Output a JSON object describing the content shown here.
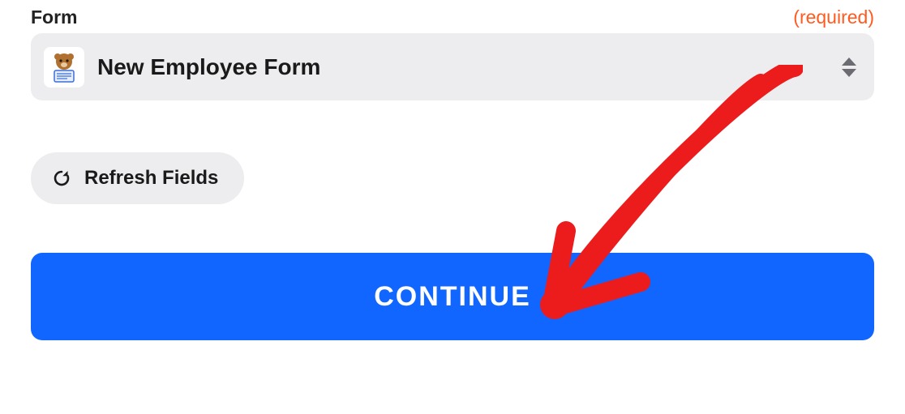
{
  "form_field": {
    "label": "Form",
    "required_text": "(required)",
    "icon_name": "wpforms-bear-icon",
    "selected": "New Employee Form"
  },
  "refresh": {
    "label": "Refresh Fields",
    "icon_name": "refresh-icon"
  },
  "continue": {
    "label": "CONTINUE"
  },
  "colors": {
    "accent": "#1166ff",
    "required": "#ff5a1f",
    "control_bg": "#ededef"
  }
}
